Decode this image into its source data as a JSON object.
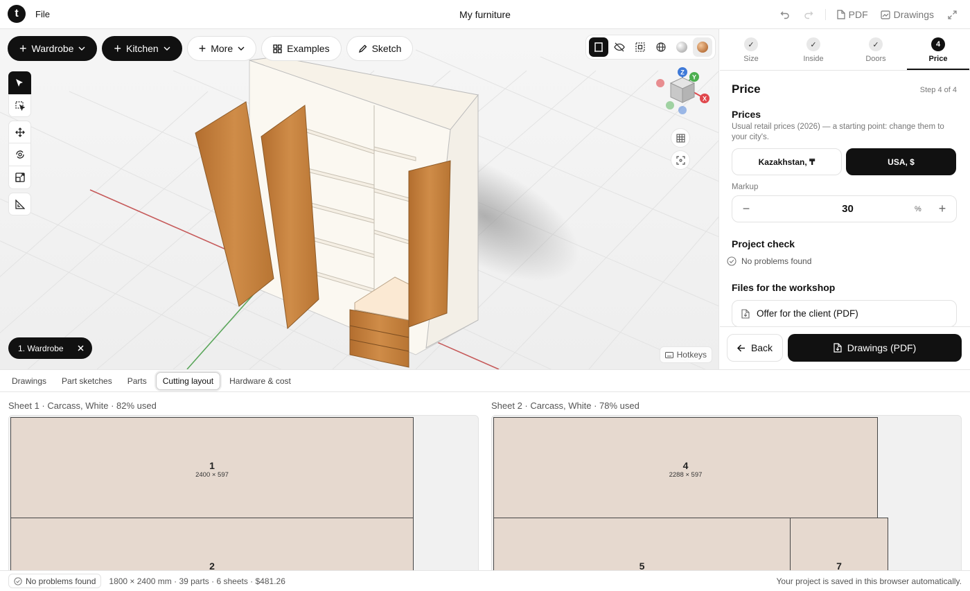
{
  "header": {
    "logo": "t",
    "file_menu": "File",
    "title": "My furniture",
    "pdf_label": "PDF",
    "drawings_label": "Drawings"
  },
  "toolbar": {
    "wardrobe": "Wardrobe",
    "kitchen": "Kitchen",
    "more": "More",
    "examples": "Examples",
    "sketch": "Sketch"
  },
  "gizmo": {
    "z": "Z",
    "y": "Y",
    "x": "X"
  },
  "selected_item": "1. Wardrobe",
  "hotkeys": "Hotkeys",
  "steps": [
    {
      "label": "Size",
      "state": "done"
    },
    {
      "label": "Inside",
      "state": "done"
    },
    {
      "label": "Doors",
      "state": "done"
    },
    {
      "label": "Price",
      "number": "4",
      "state": "active"
    }
  ],
  "panel": {
    "title": "Price",
    "step_of": "Step 4 of 4",
    "prices_title": "Prices",
    "prices_desc": "Usual retail prices (2026) — a starting point: change them to your city's.",
    "region_options": [
      "Kazakhstan, ₸",
      "USA, $"
    ],
    "region_selected": "USA, $",
    "markup_label": "Markup",
    "markup_value": "30",
    "markup_unit": "%",
    "project_check_title": "Project check",
    "project_check_status": "No problems found",
    "files_title": "Files for the workshop",
    "offer_button": "Offer for the client (PDF)",
    "back_button": "Back",
    "drawings_button": "Drawings (PDF)"
  },
  "tabs": [
    "Drawings",
    "Part sketches",
    "Parts",
    "Cutting layout",
    "Hardware & cost"
  ],
  "active_tab": "Cutting layout",
  "sheets": [
    {
      "title": "Sheet 1 · Carcass, White · 82% used",
      "parts": [
        {
          "num": "1",
          "dims": "2400 × 597"
        },
        {
          "num": "2",
          "dims": ""
        }
      ]
    },
    {
      "title": "Sheet 2 · Carcass, White · 78% used",
      "parts": [
        {
          "num": "4",
          "dims": "2288 × 597"
        },
        {
          "num": "5",
          "dims": ""
        },
        {
          "num": "7",
          "dims": ""
        }
      ]
    }
  ],
  "status": {
    "check": "No problems found",
    "info": "1800 × 2400 mm · 39 parts · 6 sheets · $481.26",
    "saved": "Your project is saved in this browser automatically."
  },
  "colors": {
    "accent": "#111111",
    "wood": "#c8843e",
    "part_fill": "#e6d9cf",
    "axis_x": "#e0474c",
    "axis_y": "#4caf50",
    "axis_z": "#3f7ad8"
  }
}
